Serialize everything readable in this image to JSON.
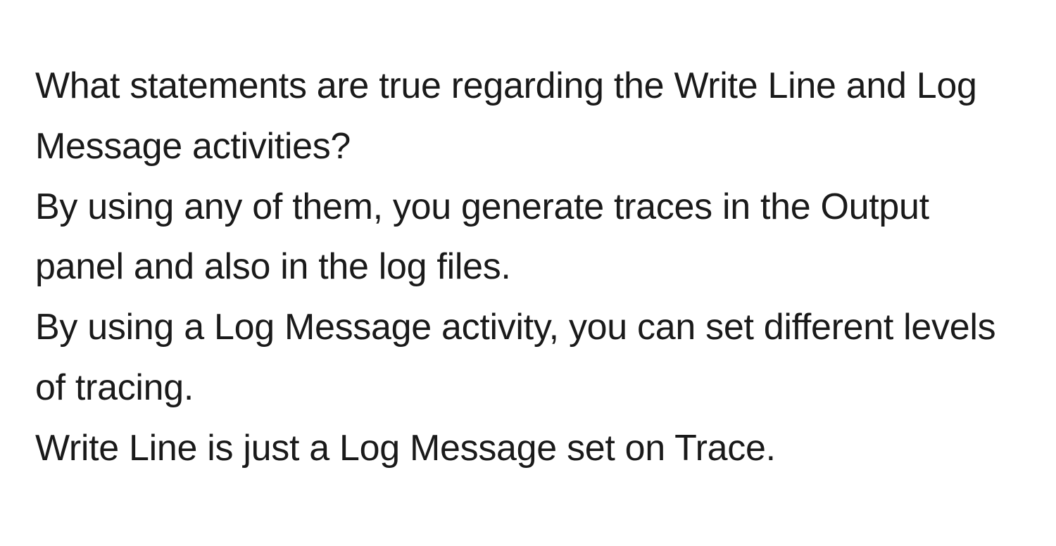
{
  "question": {
    "text": "What statements are true regarding the Write Line and Log Message activities?"
  },
  "options": [
    {
      "text": "By using any of them, you generate traces in the Output panel and also in the log files."
    },
    {
      "text": "By using a Log Message activity, you can set different levels of tracing."
    },
    {
      "text": "Write Line is just a Log Message set on Trace."
    }
  ]
}
